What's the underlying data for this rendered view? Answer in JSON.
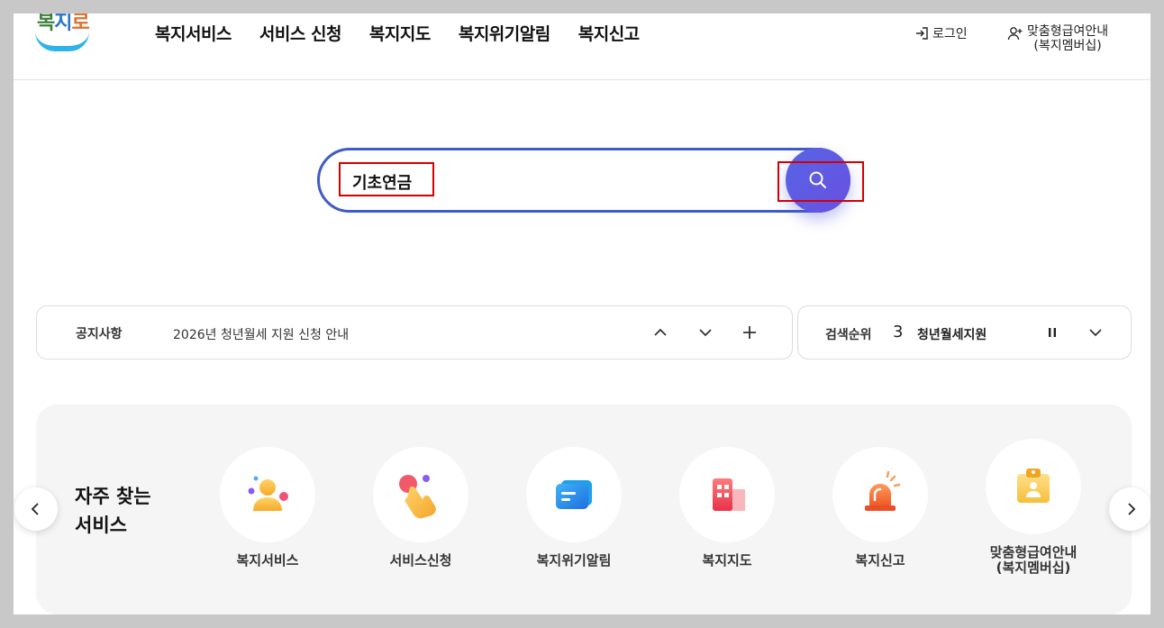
{
  "header": {
    "logo_text": [
      "복",
      "지",
      "로"
    ],
    "nav": [
      "복지서비스",
      "서비스 신청",
      "복지지도",
      "복지위기알림",
      "복지신고"
    ],
    "login_label": "로그인",
    "member_label_line1": "맞춤형급여안내",
    "member_label_line2": "(복지멤버십)"
  },
  "search": {
    "value": "기초연금",
    "button_icon": "search-icon"
  },
  "notice": {
    "label": "공지사항",
    "text": "2026년 청년월세 지원 신청 안내"
  },
  "rank": {
    "label": "검색순위",
    "number": "3",
    "text": "청년월세지원"
  },
  "frequent": {
    "title_line1": "자주 찾는",
    "title_line2": "서비스",
    "items": [
      {
        "label": "복지서비스",
        "icon": "person-icon"
      },
      {
        "label": "서비스신청",
        "icon": "hand-tap-icon"
      },
      {
        "label": "복지위기알림",
        "icon": "message-icon"
      },
      {
        "label": "복지지도",
        "icon": "building-icon"
      },
      {
        "label": "복지신고",
        "icon": "siren-icon"
      },
      {
        "label": "맞춤형급여안내\n(복지멤버십)",
        "label_line1": "맞춤형급여안내",
        "label_line2": "(복지멤버십)",
        "icon": "member-card-icon"
      }
    ]
  },
  "colors": {
    "accent": "#3f5bc9",
    "search_button": "#5a5ce4",
    "highlight": "#d40000"
  }
}
